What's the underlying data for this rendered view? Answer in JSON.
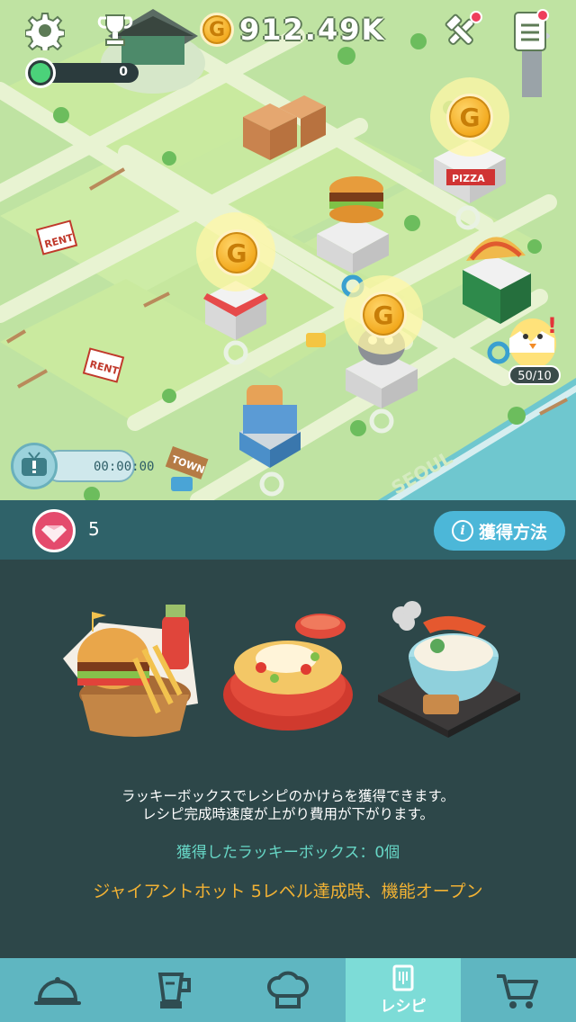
{
  "header": {
    "settings_icon": "gear-icon",
    "trophy_icon": "trophy-icon",
    "currency_icon": "gold-coin-icon",
    "currency_value": "912.49K",
    "tools_icon": "hammer-wrench-icon",
    "notes_icon": "notepad-icon",
    "level_value": "0"
  },
  "map": {
    "coin_symbol": "G",
    "rent_sign_1": "RENT",
    "rent_sign_2": "RENT",
    "pizza_sign": "PIZZA",
    "town_sign": "TOWN",
    "seoul_label": "SEOUL",
    "tv_timer": "00:00:00",
    "chick_count": "50/10"
  },
  "gems": {
    "count": "5",
    "how_button": "獲得方法",
    "info_glyph": "i"
  },
  "recipe": {
    "description_line1": "ラッキーボックスでレシピのかけらを獲得できます。",
    "description_line2": "レシピ完成時速度が上がり費用が下がります。",
    "acquired": "獲得したラッキーボックス：0個",
    "unlock": "ジャイアントホット 5レベル達成時、機能オープン"
  },
  "nav": {
    "items": [
      {
        "icon": "cloche-icon",
        "label": ""
      },
      {
        "icon": "blender-icon",
        "label": ""
      },
      {
        "icon": "chef-hat-icon",
        "label": ""
      },
      {
        "icon": "recipe-book-icon",
        "label": "レシピ"
      },
      {
        "icon": "cart-icon",
        "label": ""
      }
    ],
    "active_index": 3
  },
  "colors": {
    "map_grass": "#bfe3a2",
    "gem_bar": "#2f6269",
    "panel": "#2d4749",
    "nav": "#5fb6c1",
    "nav_active": "#7ddcd7",
    "accent_teal": "#67d7c6",
    "accent_orange": "#f2b234"
  }
}
